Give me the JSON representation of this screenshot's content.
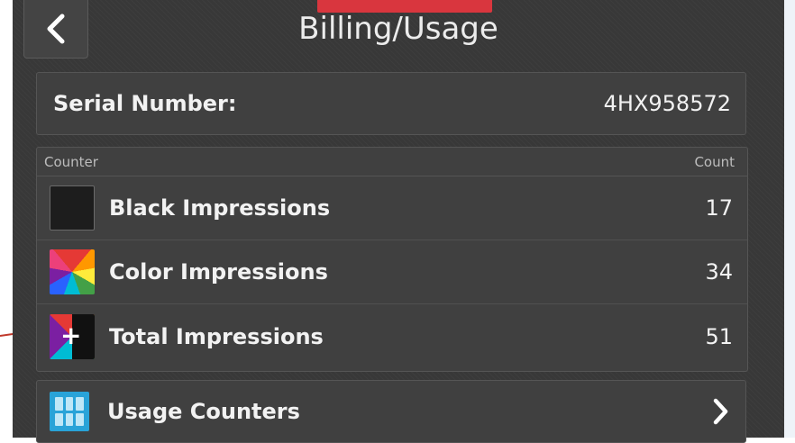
{
  "header": {
    "title": "Billing/Usage",
    "back_icon": "chevron-left-icon"
  },
  "serial": {
    "label": "Serial Number:",
    "value": "4HX958572"
  },
  "counters": {
    "column_counter": "Counter",
    "column_count": "Count",
    "rows": [
      {
        "label": "Black Impressions",
        "value": "17",
        "icon": "black-impressions-icon"
      },
      {
        "label": "Color Impressions",
        "value": "34",
        "icon": "color-impressions-icon"
      },
      {
        "label": "Total Impressions",
        "value": "51",
        "icon": "total-impressions-icon"
      }
    ]
  },
  "usage": {
    "label": "Usage Counters",
    "icon": "usage-counters-icon",
    "chevron_icon": "chevron-right-icon"
  },
  "colors": {
    "screen_background": "#383838",
    "panel_background": "#404040",
    "accent_red": "#d9363e",
    "usage_icon_blue": "#29a3d8",
    "text": "#f2f2f2"
  }
}
